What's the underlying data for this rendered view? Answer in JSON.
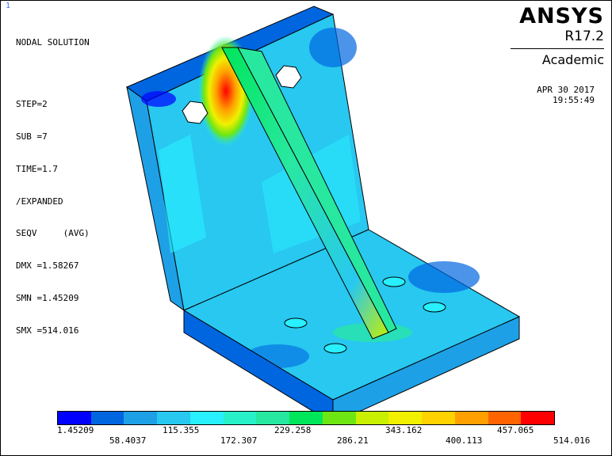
{
  "window_number": "1",
  "info": {
    "title": "NODAL SOLUTION",
    "step": "STEP=2",
    "sub": "SUB =7",
    "time": "TIME=1.7",
    "expanded": "/EXPANDED",
    "result": "SEQV     (AVG)",
    "dmx": "DMX =1.58267",
    "smn": "SMN =1.45209",
    "smx": "SMX =514.016"
  },
  "brand": {
    "name": "ANSYS",
    "version": "R17.2",
    "edition": "Academic"
  },
  "date": "APR 30 2017",
  "time": "19:55:49",
  "legend": {
    "colors": [
      "#0000ff",
      "#0066e0",
      "#1ea0e6",
      "#28c8f0",
      "#28f0ff",
      "#28f0c8",
      "#28e8a0",
      "#00e65a",
      "#6ee614",
      "#c8f000",
      "#f0f000",
      "#ffd200",
      "#ffa000",
      "#ff6400",
      "#ff0000"
    ],
    "labels_top": [
      "1.45209",
      "115.355",
      "229.258",
      "343.162",
      "457.065"
    ],
    "labels_bottom": [
      "58.4037",
      "172.307",
      "286.21",
      "400.113",
      "514.016"
    ]
  }
}
